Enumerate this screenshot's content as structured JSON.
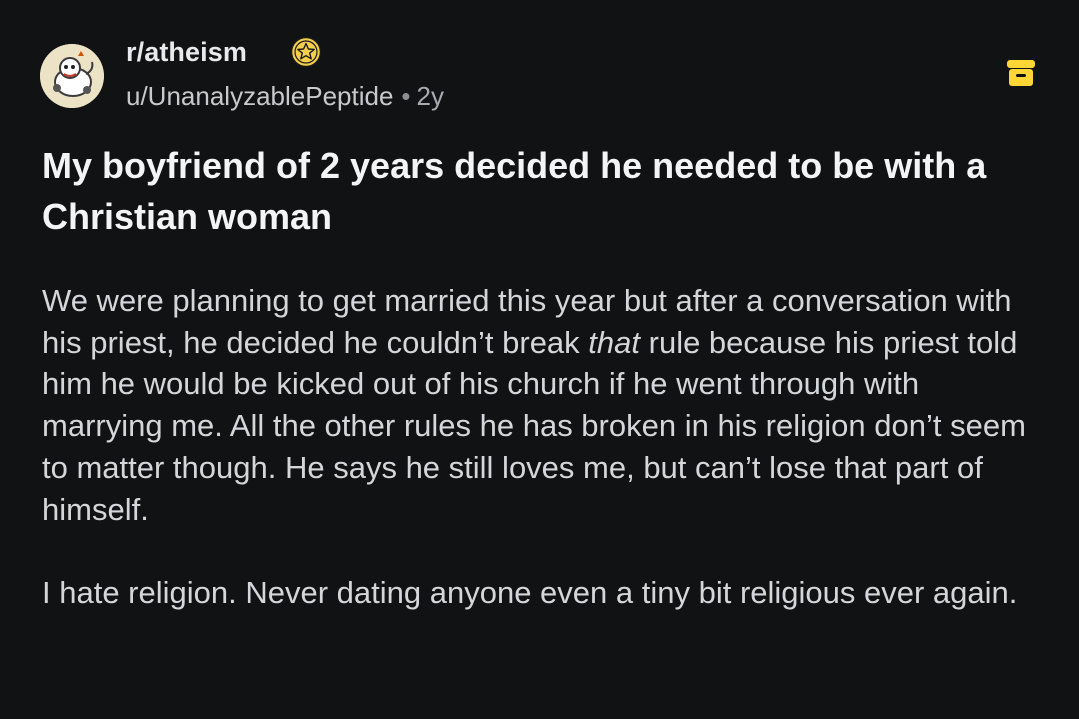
{
  "post": {
    "subreddit": "r/atheism",
    "author": "u/UnanalyzablePeptide",
    "separator": "•",
    "age": "2y",
    "title": "My boyfriend of 2 years decided he needed to be with a Christian woman",
    "body": {
      "p1_before": "We were planning to get married this year but after a conversation with his priest, he decided he couldn’t break ",
      "p1_emph": "that",
      "p1_after": " rule because his priest told him he would be kicked out of his church if he went through with marrying me. All the other rules he has broken in his religion don’t seem to matter though. He says he still loves me, but can’t lose that part of himself.",
      "p2": "I hate religion. Never dating anyone even a tiny bit religious ever again."
    }
  },
  "icons": {
    "avatar": "avatar-icon",
    "badge": "star-badge-icon",
    "save": "save-archive-icon"
  },
  "colors": {
    "background": "#111214",
    "title": "#f3f4f5",
    "body_text": "#d4d7da",
    "badge_yellow": "#f5cf4b",
    "save_yellow": "#ffd635"
  }
}
